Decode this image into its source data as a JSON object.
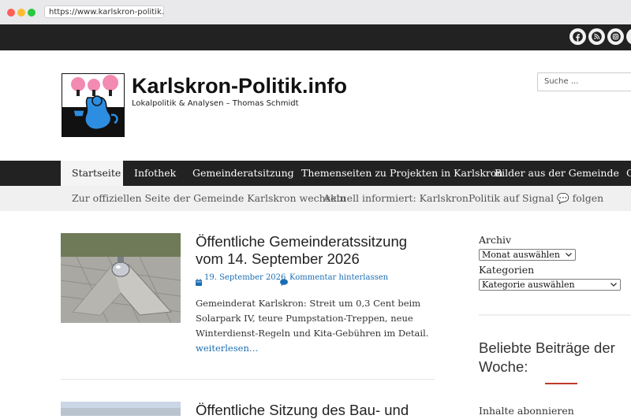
{
  "browser": {
    "url": "https://www.karlskron-politik.info/",
    "dot_colors": [
      "#fe5f57",
      "#febc2e",
      "#28c840"
    ]
  },
  "social": {
    "icons": [
      "facebook-icon",
      "rss-icon",
      "instagram-icon"
    ]
  },
  "header": {
    "site_title": "Karlskron-Politik.info",
    "tagline": "Lokalpolitik & Analysen – Thomas Schmidt",
    "search_placeholder": "Suche ..."
  },
  "nav": {
    "items": [
      {
        "label": "Startseite",
        "active": true
      },
      {
        "label": "Infothek"
      },
      {
        "label": "Gemeinderatsitzung"
      },
      {
        "label": "Themenseiten zu Projekten in Karlskron"
      },
      {
        "label": "Bilder aus der Gemeinde"
      },
      {
        "label": "G"
      }
    ]
  },
  "subnav": {
    "items": [
      "Zur offiziellen Seite der Gemeinde Karlskron wechseln",
      "Aktuell informiert: KarlskronPolitik auf Signal 💬 folgen"
    ]
  },
  "posts": [
    {
      "title_line1": "Öffentliche Gemeinderatssitzung",
      "title_line2": "vom 14. September 2026",
      "date": "19. September 2026",
      "comment": "Kommentar hinterlassen",
      "excerpt": "Gemeinderat Karlskron: Streit um 0,3 Cent beim Solarpark IV, teure Pumpstation-Treppen, neue Winterdienst-Regeln und Kita-Gebühren im Detail.",
      "read_more": "weiterlesen…"
    },
    {
      "title_line1": "Öffentliche Sitzung des Bau- und"
    }
  ],
  "sidebar": {
    "archive_label": "Archiv",
    "archive_select": "Monat auswählen",
    "categories_label": "Kategorien",
    "categories_select": "Kategorie auswählen",
    "widget_title": "Beliebte Beiträge der Woche:",
    "subscribe_label": "Inhalte abonnieren"
  },
  "colors": {
    "topbar": "#222222",
    "link": "#1b6db3",
    "accent": "#c0392b"
  }
}
